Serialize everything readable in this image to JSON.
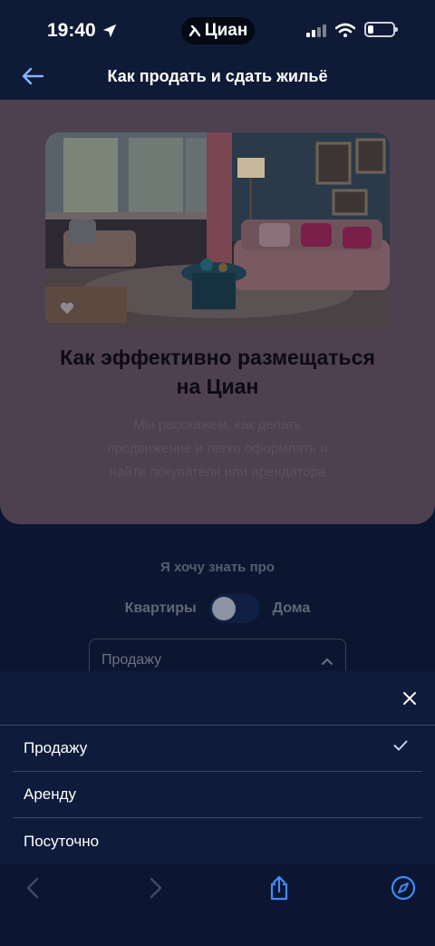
{
  "status_bar": {
    "time": "19:40",
    "app_name": "Циан"
  },
  "header": {
    "title": "Как продать и сдать жильё"
  },
  "article": {
    "title": "Как эффективно размещаться на Циан",
    "description": "Мы расскажем, как делать продвижение и легко оформлять и найти покупателя или арендатора"
  },
  "filter": {
    "label": "Я хочу знать про",
    "toggle_left": "Квартиры",
    "toggle_right": "Дома",
    "select_value": "Продажу"
  },
  "sheet": {
    "options": [
      {
        "label": "Продажу",
        "selected": true
      },
      {
        "label": "Аренду",
        "selected": false
      },
      {
        "label": "Посуточно",
        "selected": false
      }
    ]
  },
  "colors": {
    "accent": "#3f8cff",
    "background": "#0c1630",
    "sheet": "#0f1b3a"
  }
}
